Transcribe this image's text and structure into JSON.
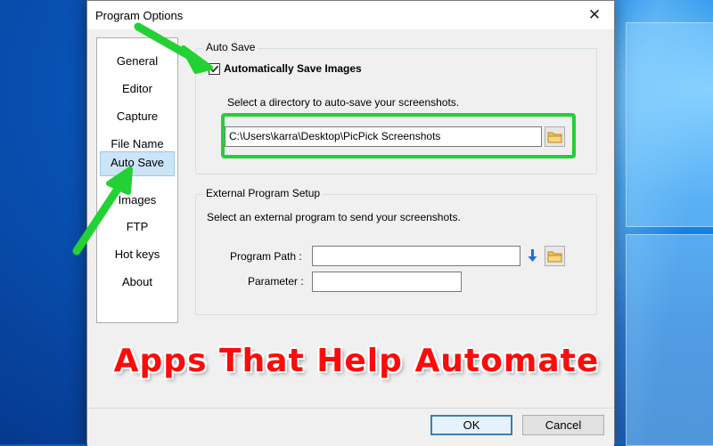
{
  "window": {
    "title": "Program Options",
    "close_glyph": "✕"
  },
  "nav": {
    "items": [
      {
        "label": "General"
      },
      {
        "label": "Editor"
      },
      {
        "label": "Capture"
      },
      {
        "label": "File Name"
      },
      {
        "label": "Auto Save",
        "active": true
      },
      {
        "label": "Images"
      },
      {
        "label": "FTP"
      },
      {
        "label": "Hot keys"
      },
      {
        "label": "About"
      }
    ]
  },
  "auto_save": {
    "group_label": "Auto Save",
    "checkbox_label": "Automatically Save Images",
    "checked": true,
    "directory_prompt": "Select a directory to auto-save your screenshots.",
    "directory_value": "C:\\Users\\karra\\Desktop\\PicPick Screenshots"
  },
  "external_program": {
    "group_label": "External Program Setup",
    "prompt": "Select an external program to send your screenshots.",
    "program_path_label": "Program Path :",
    "program_path_value": "",
    "parameter_label": "Parameter :",
    "parameter_value": ""
  },
  "footer": {
    "ok_label": "OK",
    "cancel_label": "Cancel"
  },
  "overlay": {
    "headline": "Apps That Help Automate",
    "highlight_color": "#22d133",
    "headline_color": "#ff0a0a"
  },
  "icons": [
    "close-icon",
    "folder-icon",
    "down-arrow-icon",
    "checkmark-icon",
    "green-arrow-icon"
  ]
}
